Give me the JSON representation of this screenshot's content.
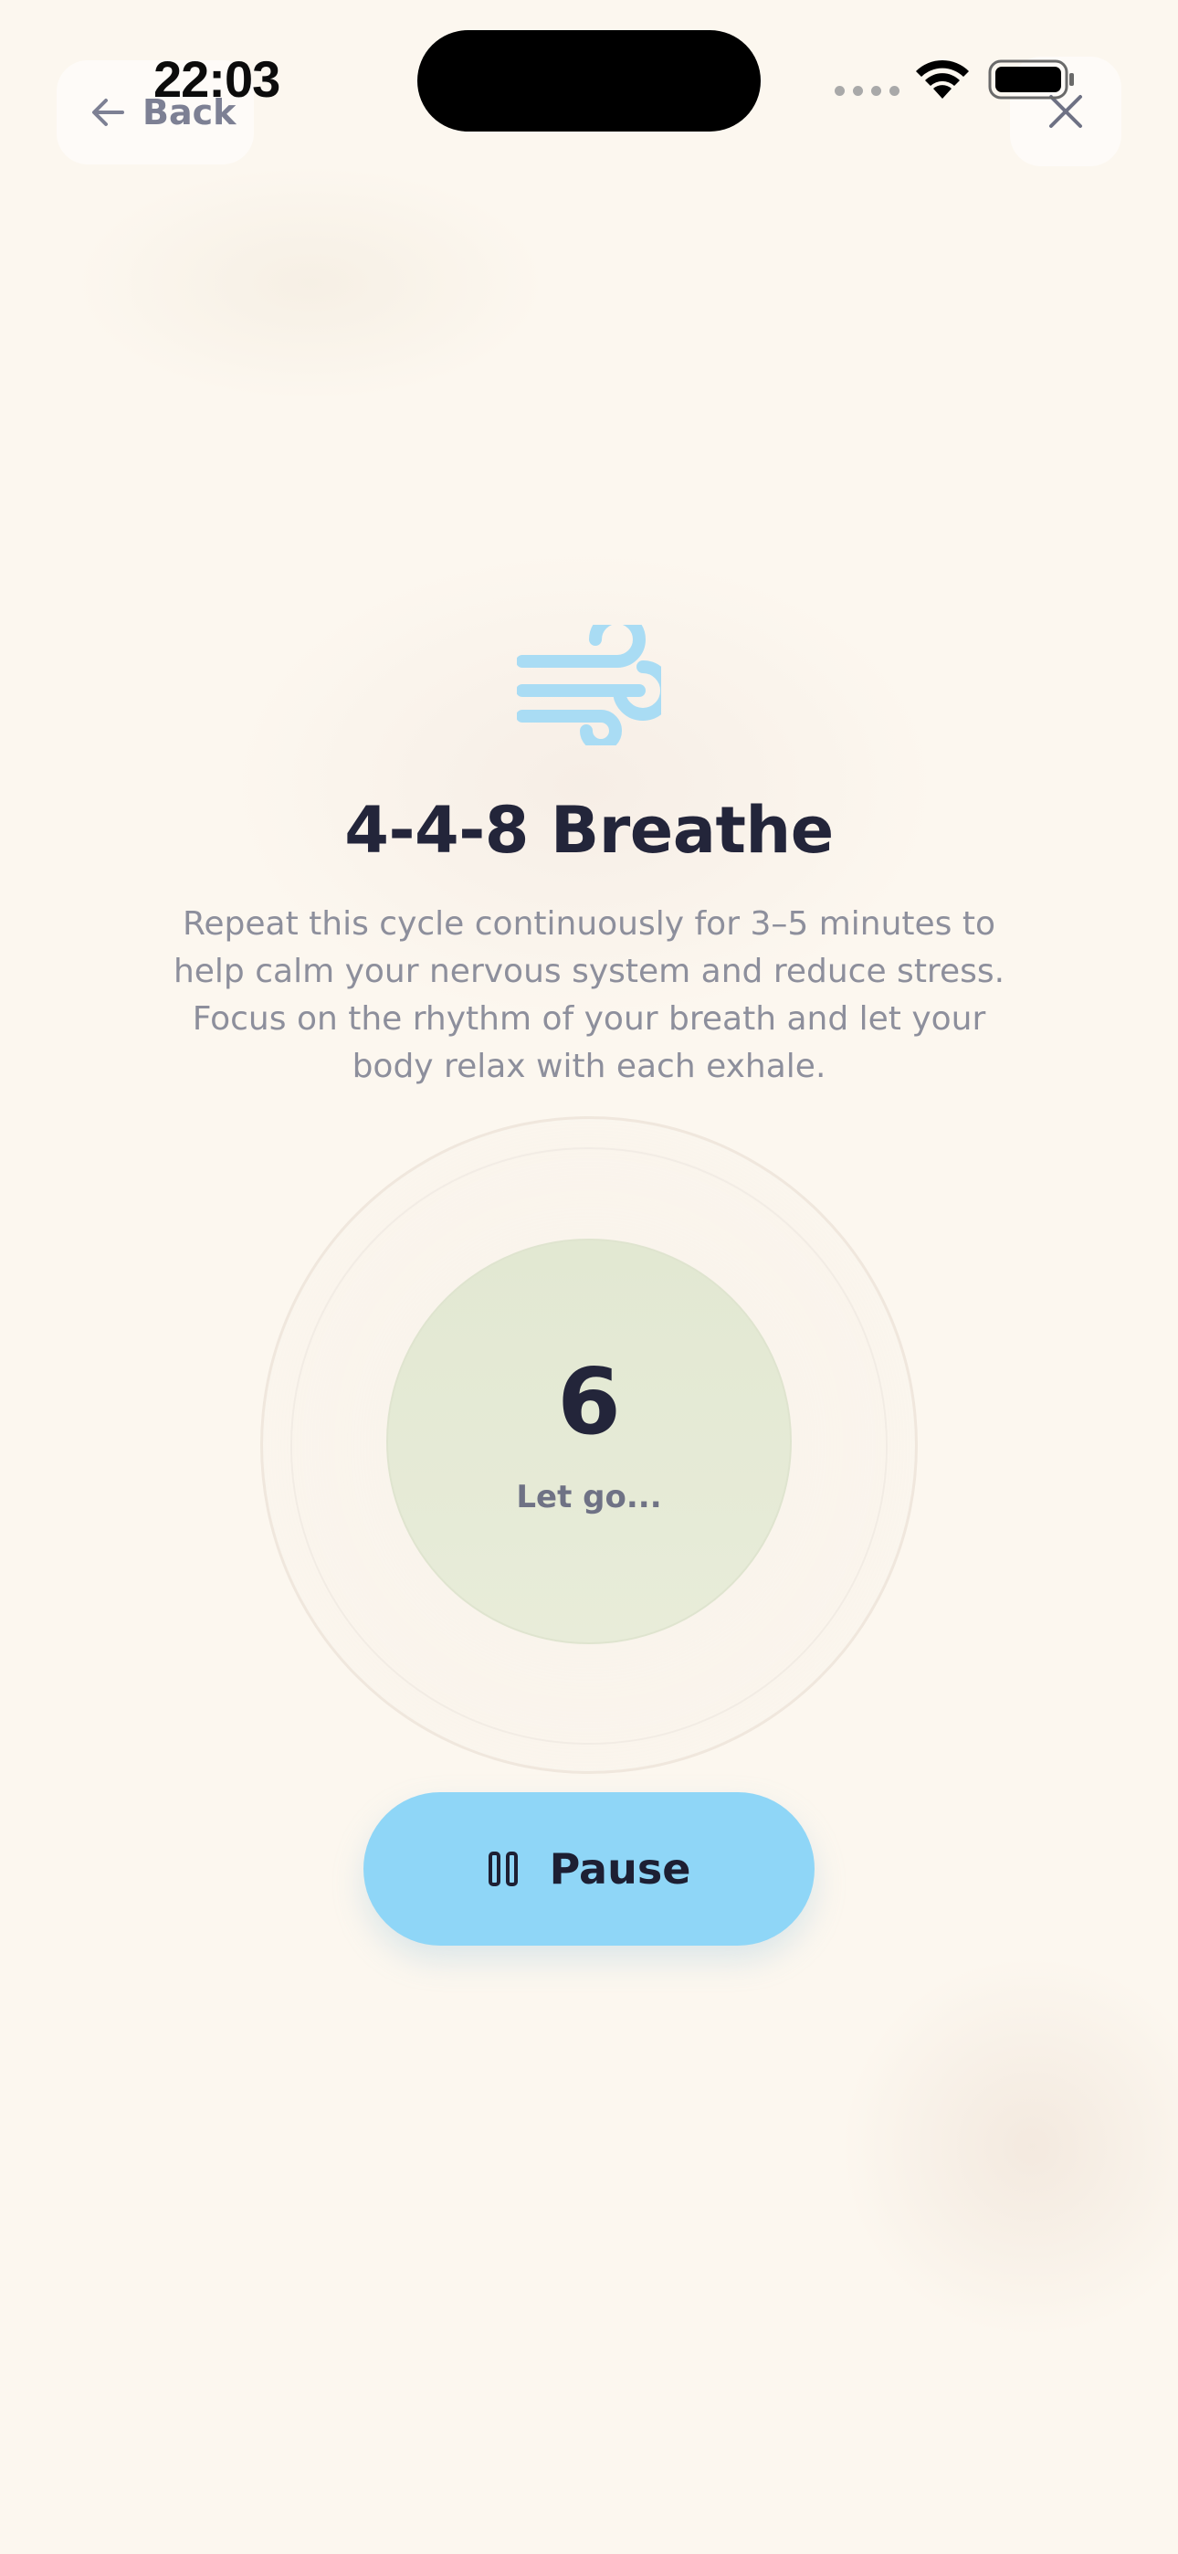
{
  "status_bar": {
    "time": "22:03"
  },
  "nav": {
    "back_label": "Back"
  },
  "exercise": {
    "title": "4-4-8 Breathe",
    "description": "Repeat this cycle continuously for 3–5 minutes to help calm your nervous system and reduce stress. Focus on the rhythm of your breath and let your body relax with each exhale.",
    "counter": "6",
    "phase": "Let go..."
  },
  "controls": {
    "pause_label": "Pause"
  },
  "colors": {
    "background": "#fcf7ef",
    "accent_blue": "#8fd6f7",
    "circle_green": "#e2e8d2",
    "title_text": "#23253a"
  },
  "icons": {
    "back": "arrow-left-icon",
    "close": "close-icon",
    "header": "wind-icon",
    "pause": "pause-icon"
  }
}
